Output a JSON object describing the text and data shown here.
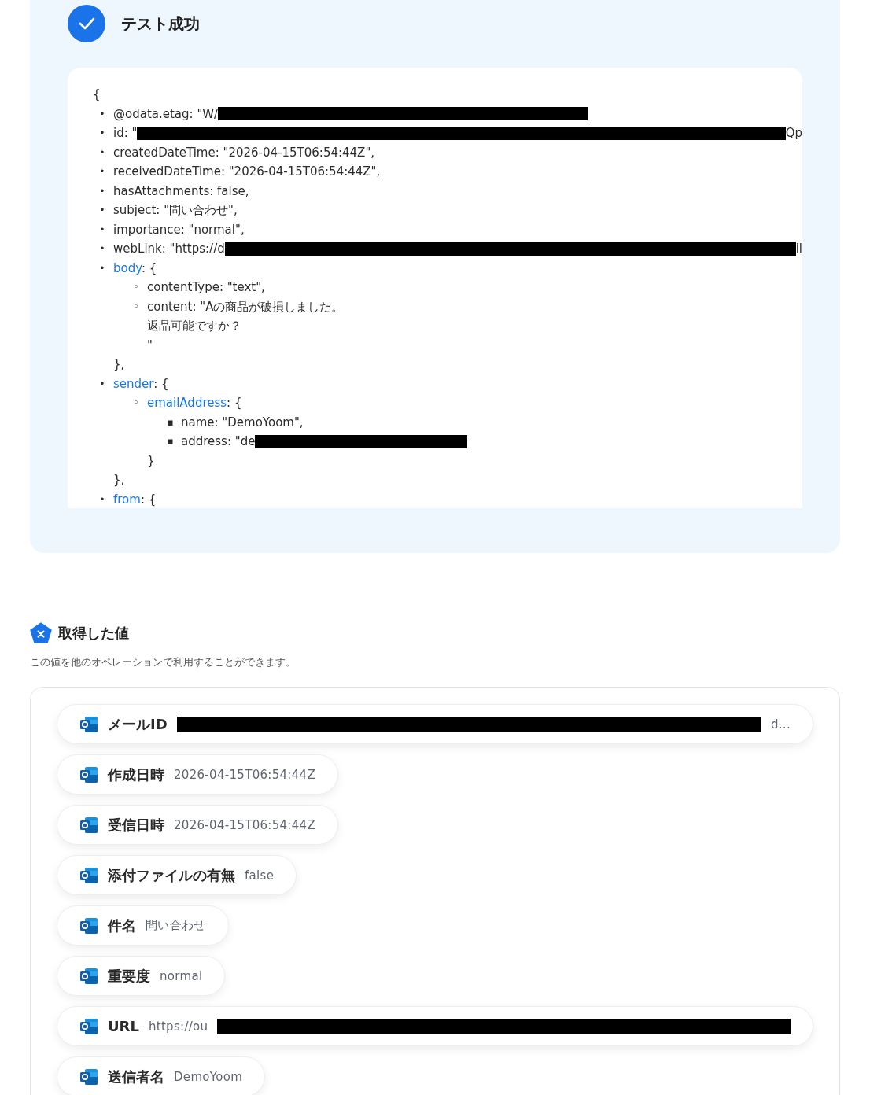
{
  "result": {
    "title": "テスト成功",
    "open": "{",
    "items": [
      {
        "kind": "value",
        "marker": "•",
        "text": "@odata.etag: \"W/",
        "redacted": true
      },
      {
        "kind": "value",
        "marker": "•",
        "text": "id: \"",
        "redacted": true,
        "tail": "Qp"
      },
      {
        "kind": "value",
        "marker": "•",
        "text": "createdDateTime: \"2026-04-15T06:54:44Z\","
      },
      {
        "kind": "value",
        "marker": "•",
        "text": "receivedDateTime: \"2026-04-15T06:54:44Z\","
      },
      {
        "kind": "value",
        "marker": "•",
        "text": "hasAttachments: false,"
      },
      {
        "kind": "value",
        "marker": "•",
        "text": "subject: \"問い合わせ\","
      },
      {
        "kind": "value",
        "marker": "•",
        "text": "importance: \"normal\","
      },
      {
        "kind": "value",
        "marker": "•",
        "text": "webLink: \"https://d",
        "redacted": true,
        "tail": "il"
      },
      {
        "kind": "object",
        "marker": "•",
        "key": "body",
        "open": ": {",
        "close": "},",
        "children": [
          {
            "kind": "value",
            "marker": "◦",
            "text": "contentType: \"text\","
          },
          {
            "kind": "multiline",
            "marker": "◦",
            "lines": [
              "content: \"Aの商品が破損しました。",
              "返品可能ですか？",
              "\""
            ]
          }
        ]
      },
      {
        "kind": "object",
        "marker": "•",
        "key": "sender",
        "open": ": {",
        "close": "},",
        "children": [
          {
            "kind": "object",
            "marker": "◦",
            "key": "emailAddress",
            "open": ": {",
            "close": "}",
            "children": [
              {
                "kind": "value",
                "marker": "▪",
                "text": "name: \"DemoYoom\","
              },
              {
                "kind": "value",
                "marker": "▪",
                "text": "address: \"de",
                "redacted": true
              }
            ]
          }
        ]
      },
      {
        "kind": "object",
        "marker": "•",
        "key": "from",
        "open": ": {"
      }
    ]
  },
  "values": {
    "title": "取得した値",
    "description": "この値を他のオペレーションで利用することができます。",
    "chips": [
      {
        "label": "メールID",
        "redacted": true,
        "tail": "d..."
      },
      {
        "label": "作成日時",
        "value": "2026-04-15T06:54:44Z"
      },
      {
        "label": "受信日時",
        "value": "2026-04-15T06:54:44Z"
      },
      {
        "label": "添付ファイルの有無",
        "value": "false"
      },
      {
        "label": "件名",
        "value": "問い合わせ"
      },
      {
        "label": "重要度",
        "value": "normal"
      },
      {
        "label": "URL",
        "value": "https://ou",
        "redacted": true
      },
      {
        "label": "送信者名",
        "value": "DemoYoom"
      }
    ]
  }
}
